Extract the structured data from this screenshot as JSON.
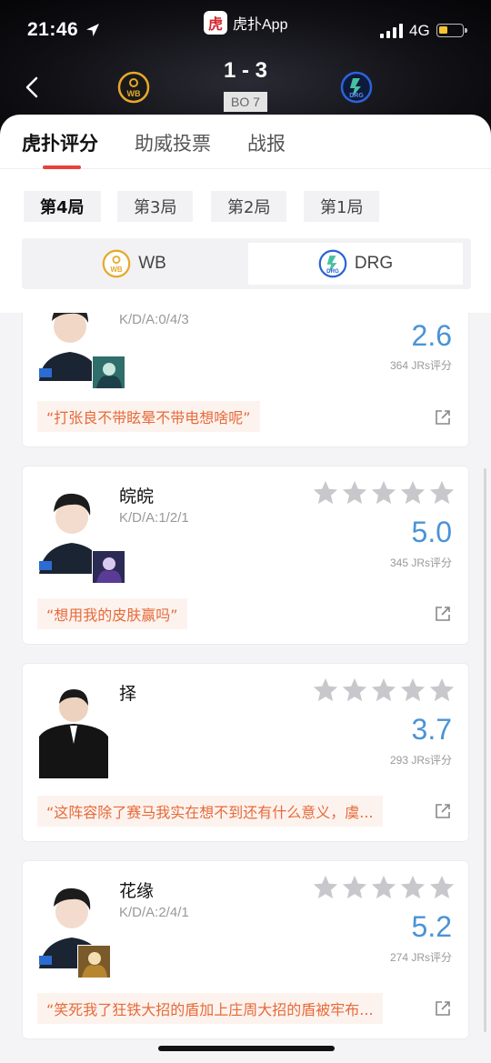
{
  "status_bar": {
    "time": "21:46",
    "network": "4G",
    "battery_level": 0.35
  },
  "header": {
    "app_name": "虎扑App",
    "app_logo_glyph": "虎",
    "score": "1 - 3",
    "series": "BO 7",
    "home_team": "WB",
    "away_team": "DRG"
  },
  "tabs": [
    {
      "label": "虎扑评分",
      "active": true
    },
    {
      "label": "助威投票",
      "active": false
    },
    {
      "label": "战报",
      "active": false
    }
  ],
  "games": [
    {
      "label": "第4局",
      "active": true
    },
    {
      "label": "第3局",
      "active": false
    },
    {
      "label": "第2局",
      "active": false
    },
    {
      "label": "第1局",
      "active": false
    }
  ],
  "team_switch": [
    {
      "label": "WB",
      "active": false
    },
    {
      "label": "DRG",
      "active": true
    }
  ],
  "players": [
    {
      "name": "",
      "kda": "K/D/A:0/4/3",
      "rating": "2.6",
      "votes": "364 JRs评分",
      "comment": "“打张良不带眩晕不带电想啥呢”"
    },
    {
      "name": "皖皖",
      "kda": "K/D/A:1/2/1",
      "rating": "5.0",
      "votes": "345 JRs评分",
      "comment": "“想用我的皮肤赢吗”"
    },
    {
      "name": "择",
      "kda": "",
      "rating": "3.7",
      "votes": "293 JRs评分",
      "comment": "“这阵容除了赛马我实在想不到还有什么意义，虞..."
    },
    {
      "name": "花缘",
      "kda": "K/D/A:2/4/1",
      "rating": "5.2",
      "votes": "274 JRs评分",
      "comment": "“笑死我了狂铁大招的盾加上庄周大招的盾被牢布..."
    }
  ],
  "colors": {
    "accent": "#e8413a",
    "rating": "#4a93d6",
    "comment_text": "#e66a3a",
    "wb_gold": "#e7a82a",
    "drg_blue": "#2b63d8"
  }
}
